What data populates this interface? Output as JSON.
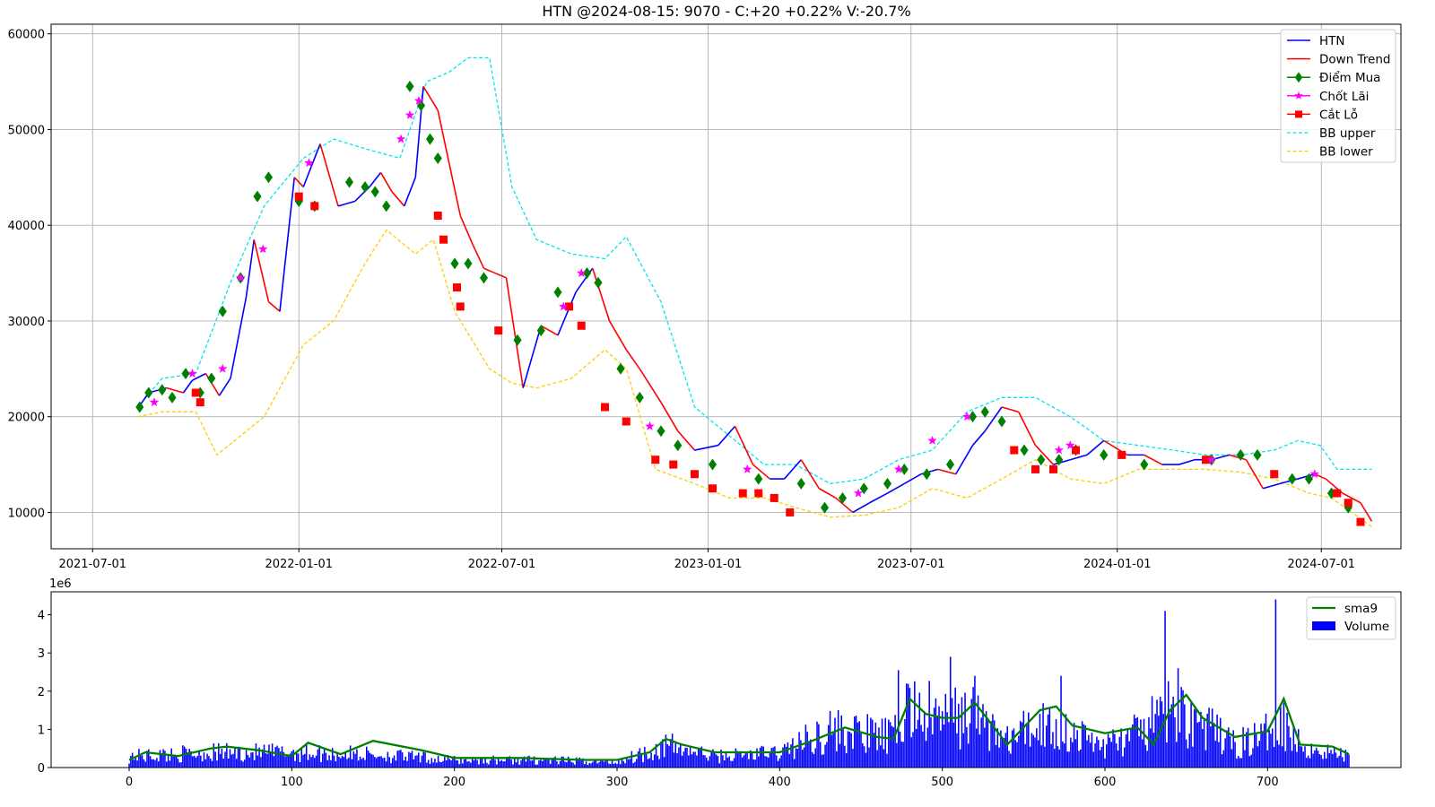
{
  "chart_data": [
    {
      "type": "line",
      "title": "HTN @2024-08-15: 9070 - C:+20 +0.22% V:-20.7%",
      "xlabel": "",
      "ylabel": "",
      "ylim": [
        6200,
        61000
      ],
      "yticks": [
        10000,
        20000,
        30000,
        40000,
        50000,
        60000
      ],
      "xticks": [
        "2021-07-01",
        "2022-01-01",
        "2022-07-01",
        "2023-01-01",
        "2023-07-01",
        "2024-01-01",
        "2024-07-01"
      ],
      "grid": true,
      "legend_position": "top-right",
      "colors": {
        "HTN": "#0000ff",
        "Down Trend": "#ff0000",
        "Điểm Mua": "#008000",
        "Chốt Lãi": "#ff00ff",
        "Cắt Lỗ": "#ff0000",
        "BB upper": "#00e5ee",
        "BB lower": "#ffcc00"
      },
      "legend": [
        "HTN",
        "Down Trend",
        "Điểm Mua",
        "Chốt Lãi",
        "Cắt Lỗ",
        "BB upper",
        "BB lower"
      ],
      "series": [
        {
          "name": "HTN",
          "x": [
            "2021-08-10",
            "2021-08-20",
            "2021-09-05",
            "2021-09-20",
            "2021-09-28",
            "2021-10-10",
            "2021-10-22",
            "2021-11-01",
            "2021-11-15",
            "2021-11-22",
            "2021-12-05",
            "2021-12-15",
            "2021-12-28",
            "2022-01-05",
            "2022-01-20",
            "2022-02-05",
            "2022-02-20",
            "2022-03-05",
            "2022-03-15",
            "2022-03-25",
            "2022-04-05",
            "2022-04-15",
            "2022-04-22",
            "2022-05-05",
            "2022-05-15",
            "2022-05-25",
            "2022-06-05",
            "2022-06-15",
            "2022-06-25",
            "2022-07-05",
            "2022-07-20",
            "2022-08-05",
            "2022-08-20",
            "2022-09-05",
            "2022-09-20",
            "2022-10-05",
            "2022-10-20",
            "2022-11-01",
            "2022-11-20",
            "2022-12-05",
            "2022-12-20",
            "2023-01-10",
            "2023-01-25",
            "2023-02-10",
            "2023-02-25",
            "2023-03-10",
            "2023-03-25",
            "2023-04-10",
            "2023-04-25",
            "2023-05-10",
            "2023-05-25",
            "2023-06-10",
            "2023-06-25",
            "2023-07-10",
            "2023-07-25",
            "2023-08-10",
            "2023-08-25",
            "2023-09-05",
            "2023-09-20",
            "2023-10-05",
            "2023-10-20",
            "2023-11-05",
            "2023-11-20",
            "2023-12-05",
            "2023-12-20",
            "2024-01-10",
            "2024-01-25",
            "2024-02-10",
            "2024-02-25",
            "2024-03-10",
            "2024-03-25",
            "2024-04-10",
            "2024-04-25",
            "2024-05-10",
            "2024-05-25",
            "2024-06-10",
            "2024-06-25",
            "2024-07-05",
            "2024-07-20",
            "2024-08-05",
            "2024-08-15"
          ],
          "values": [
            20800,
            22500,
            23000,
            22500,
            23800,
            24500,
            22200,
            24000,
            32500,
            38500,
            32000,
            31000,
            45000,
            44000,
            48500,
            42000,
            42500,
            44000,
            45500,
            43500,
            42000,
            45000,
            54500,
            52000,
            46500,
            41000,
            38000,
            35500,
            35000,
            34500,
            23000,
            29500,
            28500,
            33000,
            35500,
            30000,
            27000,
            25000,
            21500,
            18500,
            16500,
            17000,
            19000,
            15000,
            13500,
            13500,
            15500,
            12500,
            11500,
            10000,
            11000,
            12000,
            13000,
            14000,
            14500,
            14000,
            17000,
            18500,
            21000,
            20500,
            17000,
            15000,
            15500,
            16000,
            17500,
            16000,
            16000,
            15000,
            15000,
            15500,
            15500,
            16000,
            15500,
            12500,
            13000,
            13500,
            14000,
            13500,
            12000,
            11000,
            9070
          ]
        },
        {
          "name": "BB upper",
          "x": [
            "2021-08-10",
            "2021-09-01",
            "2021-10-01",
            "2021-11-01",
            "2021-12-01",
            "2022-01-05",
            "2022-02-01",
            "2022-03-01",
            "2022-04-01",
            "2022-04-25",
            "2022-05-15",
            "2022-06-01",
            "2022-06-20",
            "2022-07-10",
            "2022-08-01",
            "2022-09-01",
            "2022-10-01",
            "2022-10-20",
            "2022-11-20",
            "2022-12-20",
            "2023-01-20",
            "2023-02-20",
            "2023-03-20",
            "2023-04-20",
            "2023-05-20",
            "2023-06-20",
            "2023-07-20",
            "2023-08-20",
            "2023-09-20",
            "2023-10-20",
            "2023-11-20",
            "2023-12-20",
            "2024-01-20",
            "2024-02-20",
            "2024-03-20",
            "2024-04-20",
            "2024-05-20",
            "2024-06-10",
            "2024-06-30",
            "2024-07-15",
            "2024-08-15"
          ],
          "values": [
            21000,
            24000,
            24500,
            34000,
            42000,
            47000,
            49000,
            48000,
            47000,
            55000,
            56000,
            57500,
            57500,
            44000,
            38500,
            37000,
            36500,
            38800,
            32000,
            21000,
            18000,
            15000,
            15000,
            13000,
            13500,
            15500,
            16500,
            20500,
            22000,
            22000,
            20000,
            17500,
            17000,
            16500,
            16000,
            16000,
            16500,
            17500,
            17000,
            14500,
            14500
          ]
        },
        {
          "name": "BB lower",
          "x": [
            "2021-08-10",
            "2021-09-01",
            "2021-10-01",
            "2021-10-20",
            "2021-11-10",
            "2021-12-01",
            "2022-01-05",
            "2022-02-01",
            "2022-03-01",
            "2022-03-20",
            "2022-04-15",
            "2022-05-01",
            "2022-05-20",
            "2022-06-20",
            "2022-07-10",
            "2022-08-01",
            "2022-09-01",
            "2022-10-01",
            "2022-10-20",
            "2022-11-15",
            "2022-12-20",
            "2023-01-20",
            "2023-02-20",
            "2023-03-20",
            "2023-04-20",
            "2023-05-20",
            "2023-06-20",
            "2023-07-20",
            "2023-08-20",
            "2023-09-20",
            "2023-10-20",
            "2023-11-20",
            "2023-12-20",
            "2024-01-20",
            "2024-02-20",
            "2024-03-20",
            "2024-04-20",
            "2024-05-20",
            "2024-06-20",
            "2024-07-10",
            "2024-08-15"
          ],
          "values": [
            20000,
            20500,
            20500,
            16000,
            18000,
            20000,
            27500,
            30000,
            36000,
            39500,
            37000,
            38500,
            31000,
            25000,
            23500,
            23000,
            24000,
            27000,
            25000,
            14500,
            13000,
            11500,
            11500,
            10500,
            9500,
            9700,
            10500,
            12500,
            11500,
            13500,
            15500,
            13500,
            13000,
            14500,
            14500,
            14500,
            14200,
            13500,
            12000,
            11500,
            8500
          ]
        },
        {
          "name": "Điểm Mua",
          "x": [
            "2021-08-12",
            "2021-08-20",
            "2021-09-01",
            "2021-09-10",
            "2021-09-22",
            "2021-10-05",
            "2021-10-15",
            "2021-10-25",
            "2021-11-10",
            "2021-11-25",
            "2021-12-05",
            "2022-01-01",
            "2022-01-15",
            "2022-02-15",
            "2022-03-01",
            "2022-03-10",
            "2022-03-20",
            "2022-04-10",
            "2022-04-20",
            "2022-04-28",
            "2022-05-05",
            "2022-05-20",
            "2022-06-01",
            "2022-06-15",
            "2022-07-15",
            "2022-08-05",
            "2022-08-20",
            "2022-09-15",
            "2022-09-25",
            "2022-10-15",
            "2022-11-01",
            "2022-11-20",
            "2022-12-05",
            "2023-01-05",
            "2023-02-15",
            "2023-03-25",
            "2023-04-15",
            "2023-05-01",
            "2023-05-20",
            "2023-06-10",
            "2023-06-25",
            "2023-07-15",
            "2023-08-05",
            "2023-08-25",
            "2023-09-05",
            "2023-09-20",
            "2023-10-10",
            "2023-10-25",
            "2023-11-10",
            "2023-11-25",
            "2023-12-20",
            "2024-01-25",
            "2024-03-25",
            "2024-04-20",
            "2024-05-05",
            "2024-06-05",
            "2024-06-20",
            "2024-07-10",
            "2024-07-25"
          ],
          "values": [
            21000,
            22500,
            22800,
            22000,
            24500,
            22500,
            24000,
            31000,
            34500,
            43000,
            45000,
            42500,
            42000,
            44500,
            44000,
            43500,
            42000,
            54500,
            52500,
            49000,
            47000,
            36000,
            36000,
            34500,
            28000,
            29000,
            33000,
            35000,
            34000,
            25000,
            22000,
            18500,
            17000,
            15000,
            13500,
            13000,
            10500,
            11500,
            12500,
            13000,
            14500,
            14000,
            15000,
            20000,
            20500,
            19500,
            16500,
            15500,
            15500,
            16500,
            16000,
            15000,
            15500,
            16000,
            16000,
            13500,
            13500,
            12000,
            10500
          ]
        },
        {
          "name": "Chốt Lãi",
          "x": [
            "2021-08-25",
            "2021-09-28",
            "2021-10-25",
            "2021-11-10",
            "2021-11-30",
            "2022-01-10",
            "2022-04-02",
            "2022-04-10",
            "2022-04-18",
            "2022-08-25",
            "2022-09-10",
            "2022-11-10",
            "2023-02-05",
            "2023-05-15",
            "2023-06-20",
            "2023-07-20",
            "2023-08-20",
            "2023-11-10",
            "2023-11-20",
            "2024-03-25",
            "2024-06-25"
          ],
          "values": [
            21500,
            24500,
            25000,
            34500,
            37500,
            46500,
            49000,
            51500,
            53000,
            31500,
            35000,
            19000,
            14500,
            12000,
            14500,
            17500,
            20000,
            16500,
            17000,
            15500,
            14000
          ]
        },
        {
          "name": "Cắt Lỗ",
          "x": [
            "2021-10-01",
            "2021-10-05",
            "2022-01-01",
            "2022-01-15",
            "2022-05-05",
            "2022-05-10",
            "2022-05-22",
            "2022-05-25",
            "2022-06-28",
            "2022-08-30",
            "2022-09-10",
            "2022-10-01",
            "2022-10-20",
            "2022-11-15",
            "2022-12-01",
            "2022-12-20",
            "2023-01-05",
            "2023-02-01",
            "2023-02-15",
            "2023-03-01",
            "2023-03-15",
            "2023-10-01",
            "2023-10-20",
            "2023-11-05",
            "2023-11-25",
            "2024-01-05",
            "2024-03-20",
            "2024-05-20",
            "2024-07-15",
            "2024-07-25",
            "2024-08-05"
          ],
          "values": [
            22500,
            21500,
            43000,
            42000,
            41000,
            38500,
            33500,
            31500,
            29000,
            31500,
            29500,
            21000,
            19500,
            15500,
            15000,
            14000,
            12500,
            12000,
            12000,
            11500,
            10000,
            16500,
            14500,
            14500,
            16500,
            16000,
            15500,
            14000,
            12000,
            11000,
            9000
          ]
        }
      ]
    },
    {
      "type": "bar",
      "title": "",
      "xlabel": "",
      "ylabel": "",
      "yscale_label": "1e6",
      "ylim": [
        0,
        4.6
      ],
      "xlim": [
        -48,
        782
      ],
      "xticks": [
        0,
        100,
        200,
        300,
        400,
        500,
        600,
        700
      ],
      "yticks": [
        0,
        1,
        2,
        3,
        4
      ],
      "grid": false,
      "legend_position": "top-right",
      "legend": [
        "sma9",
        "Volume"
      ],
      "colors": {
        "sma9": "#008000",
        "Volume": "#0000ff"
      },
      "series": [
        {
          "name": "Volume",
          "x_range": [
            0,
            750
          ],
          "profile_x": [
            0,
            50,
            100,
            150,
            200,
            250,
            300,
            330,
            360,
            400,
            430,
            470,
            480,
            500,
            520,
            540,
            560,
            580,
            600,
            620,
            640,
            650,
            680,
            700,
            705,
            720,
            750
          ],
          "profile_y": [
            0.3,
            0.4,
            0.4,
            0.35,
            0.2,
            0.2,
            0.15,
            0.6,
            0.3,
            0.4,
            1.0,
            0.8,
            1.6,
            1.3,
            1.4,
            0.7,
            1.2,
            0.9,
            0.6,
            0.9,
            1.5,
            1.4,
            0.6,
            0.9,
            1.6,
            0.6,
            0.3
          ],
          "spikes": [
            [
              473,
              2.55
            ],
            [
              505,
              2.9
            ],
            [
              637,
              4.1
            ],
            [
              705,
              4.4
            ],
            [
              478,
              2.2
            ],
            [
              520,
              2.4
            ],
            [
              573,
              2.4
            ],
            [
              645,
              2.6
            ]
          ]
        },
        {
          "name": "sma9",
          "x": [
            0,
            10,
            30,
            50,
            60,
            80,
            100,
            110,
            130,
            150,
            180,
            200,
            240,
            280,
            300,
            320,
            330,
            340,
            360,
            380,
            400,
            420,
            440,
            460,
            470,
            480,
            490,
            500,
            510,
            520,
            540,
            560,
            570,
            580,
            600,
            620,
            630,
            640,
            650,
            660,
            680,
            700,
            710,
            720,
            740,
            750
          ],
          "values": [
            0.2,
            0.4,
            0.3,
            0.5,
            0.55,
            0.45,
            0.3,
            0.65,
            0.35,
            0.7,
            0.45,
            0.25,
            0.25,
            0.2,
            0.2,
            0.4,
            0.75,
            0.6,
            0.4,
            0.4,
            0.4,
            0.7,
            1.05,
            0.8,
            0.75,
            1.8,
            1.4,
            1.3,
            1.3,
            1.7,
            0.6,
            1.5,
            1.6,
            1.1,
            0.9,
            1.05,
            0.6,
            1.5,
            1.9,
            1.3,
            0.8,
            0.95,
            1.8,
            0.6,
            0.55,
            0.35
          ]
        }
      ]
    }
  ]
}
